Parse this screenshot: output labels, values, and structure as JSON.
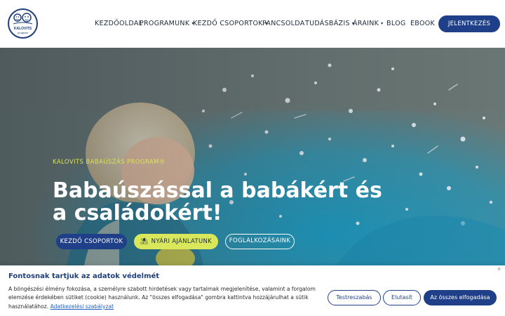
{
  "header": {
    "logo_line1": "KALOVITS",
    "logo_line2": "program",
    "nav": [
      {
        "label": "KEZDŐOLDAL"
      },
      {
        "label": "PROGRAMUNK"
      },
      {
        "label": "KEZDŐ CSOPORTOK"
      },
      {
        "label": "PANCSOLDA"
      },
      {
        "label": "TUDÁSBÁZIS"
      },
      {
        "label": "ÁRAINK"
      },
      {
        "label": "BLOG"
      },
      {
        "label": "EBOOK"
      }
    ],
    "login_label": "JELENTKEZÉS"
  },
  "hero": {
    "eyebrow": "KALOVITS BABAÚSZÁS PROGRAM®",
    "headline": "Babaúszással a babákért és a családokért!",
    "buttons": {
      "starter_groups": "KEZDŐ CSOPORTOK",
      "summer_offers": "NYÁRI AJÁNLATUNK",
      "activities": "FOGLALKOZÁSAINK"
    }
  },
  "cookie": {
    "title": "Fontosnak tartjuk az adatok védelmét",
    "text": "A böngészési élmény fokozása, a személyre szabott hirdetések vagy tartalmak megjelenítése, valamint a forgalom elemzése érdekében sütiket (cookie) használunk. Az \"összes elfogadása\" gombra kattintva hozzájárulhat a sütik használatához.",
    "link": "Adatkezelési szabályzat",
    "customize": "Testreszabás",
    "reject": "Elutasít",
    "accept_all": "Az összes elfogadása",
    "close": "×"
  },
  "colors": {
    "brand_blue": "#1f3f88",
    "accent_yellow": "#d8e85a",
    "text_dark": "#1d2a3c"
  }
}
